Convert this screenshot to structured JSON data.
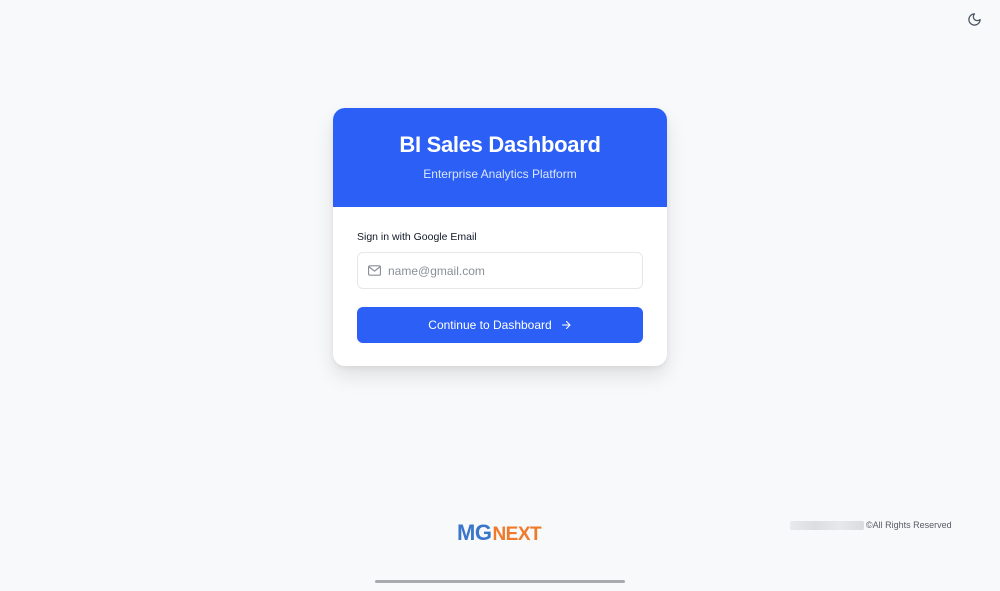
{
  "header": {
    "title": "BI Sales Dashboard",
    "subtitle": "Enterprise Analytics Platform"
  },
  "form": {
    "label": "Sign in with Google Email",
    "email_placeholder": "name@gmail.com",
    "email_value": "",
    "button_label": "Continue to Dashboard"
  },
  "logo": {
    "part1": "MG",
    "part2": "NEXT"
  },
  "footer": {
    "rights": "©All Rights Reserved"
  },
  "icons": {
    "theme_toggle": "moon-icon",
    "email_field": "mail-icon",
    "button": "arrow-right-icon"
  },
  "colors": {
    "accent": "#2b5ff5",
    "logo_blue": "#3a76c9",
    "logo_orange": "#f07a2a"
  }
}
